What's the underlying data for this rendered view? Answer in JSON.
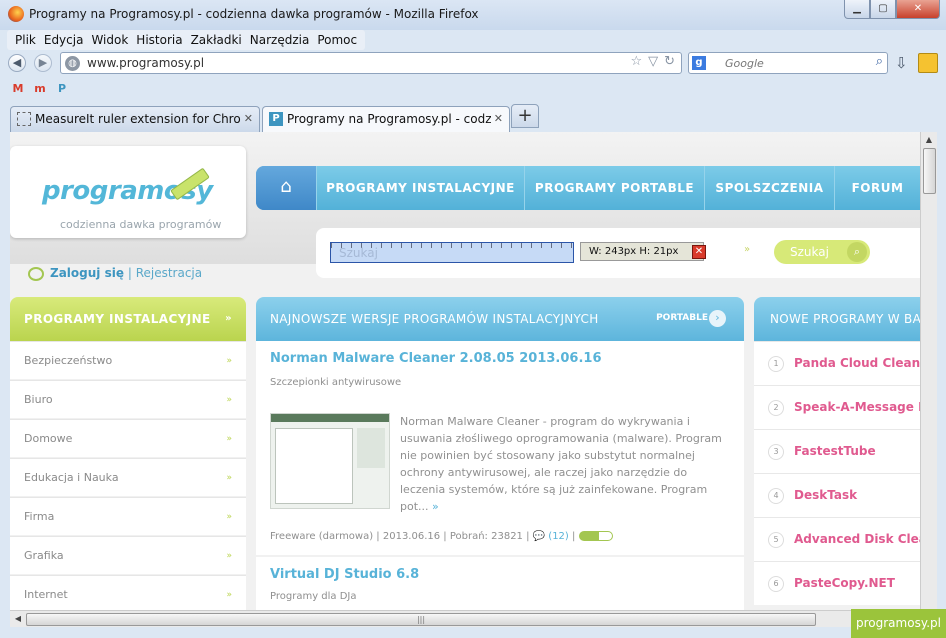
{
  "window": {
    "title": "Programy na Programosy.pl - codzienna dawka programów - Mozilla Firefox",
    "minimize": "▁",
    "maximize": "▢",
    "close": "✕"
  },
  "menu": [
    "Plik",
    "Edycja",
    "Widok",
    "Historia",
    "Zakładki",
    "Narzędzia",
    "Pomoc"
  ],
  "nav": {
    "url": "www.programosy.pl",
    "search_placeholder": "Google"
  },
  "bookmarks": [
    {
      "icon": "gmail-icon",
      "glyph": "M",
      "color": "#d93b2b"
    },
    {
      "icon": "m-icon",
      "glyph": "m",
      "color": "#d93b2b"
    },
    {
      "icon": "programosy-icon",
      "glyph": "P",
      "color": "#3d95c0"
    }
  ],
  "tabs": [
    {
      "label": "MeasureIt ruler extension for Chrome...",
      "close": "✕",
      "active": false
    },
    {
      "label": "Programy na Programosy.pl - codzie...",
      "close": "✕",
      "active": true
    }
  ],
  "site": {
    "logo": "programosy",
    "logo_sub": "codzienna dawka programów",
    "nav_items": [
      "PROGRAMY INSTALACYJNE",
      "PROGRAMY PORTABLE",
      "SPOLSZCZENIA",
      "FORUM"
    ],
    "search": {
      "placeholder": "Szukaj",
      "measure": "W: 243px   H: 21px",
      "measure_close": "✕",
      "button": "Szukaj"
    },
    "login": "Zaloguj się",
    "separator": "|",
    "register": "Rejestracja"
  },
  "sidebar": {
    "title": "PROGRAMY INSTALACYJNE",
    "items": [
      "Bezpieczeństwo",
      "Biuro",
      "Domowe",
      "Edukacja i Nauka",
      "Firma",
      "Grafika",
      "Internet"
    ]
  },
  "center": {
    "title": "NAJNOWSZE WERSJE PROGRAMÓW INSTALACYJNYCH",
    "link": "PORTABLE",
    "posts": [
      {
        "title": "Norman Malware Cleaner 2.08.05 2013.06.16",
        "category": "Szczepionki antywirusowe",
        "description": "Norman Malware Cleaner - program do wykrywania i usuwania złośliwego oprogramowania (malware). Program nie powinien być stosowany jako substytut normalnej ochrony antywirusowej, ale raczej jako narzędzie do leczenia systemów, które są już zainfekowane. Program pot...",
        "more": "»",
        "meta": "Freeware (darmowa) | 2013.06.16 | Pobrań: 23821 |",
        "comments": "(12)",
        "rating": 0.6
      },
      {
        "title": "Virtual DJ Studio 6.8",
        "category": "Programy dla DJa"
      }
    ]
  },
  "right": {
    "title": "NOWE PROGRAMY W BA",
    "items": [
      {
        "num": "1",
        "name": "Panda Cloud Cleaner"
      },
      {
        "num": "2",
        "name": "Speak-A-Message Hon"
      },
      {
        "num": "3",
        "name": "FastestTube"
      },
      {
        "num": "4",
        "name": "DeskTask"
      },
      {
        "num": "5",
        "name": "Advanced Disk Cleane"
      },
      {
        "num": "6",
        "name": "PasteCopy.NET"
      }
    ]
  },
  "watermark": "programosy.pl"
}
